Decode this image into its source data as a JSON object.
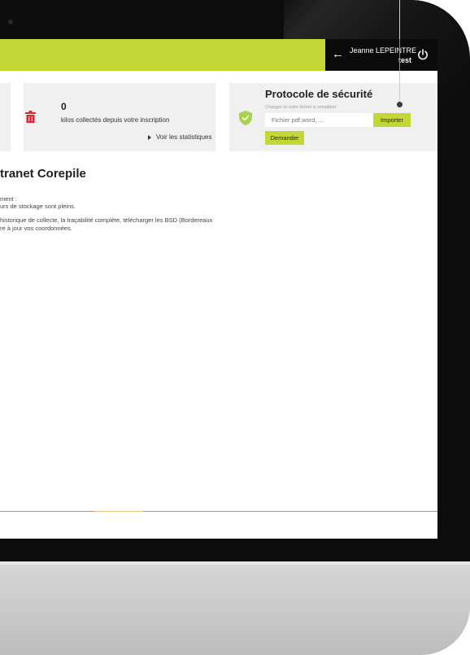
{
  "header": {
    "user_name": "Jeanne LEPEINTRE",
    "company": "test"
  },
  "collected_card": {
    "count": "0",
    "label": "kilos collectés depuis votre inscription",
    "stats_link": "Voir les statistiques"
  },
  "security": {
    "title": "Protocole de sécurité",
    "hint": "Chargez ici votre fichier à compléter",
    "file_placeholder": "Fichier pdf,word, ...",
    "import_label": "Importer",
    "request_label": "Demander"
  },
  "main": {
    "title": "tranet Corepile",
    "lines": [
      "ment :",
      "urs de stockage sont pleins.",
      "historique de collecte, la traçabilité complète, télécharger les BSD (Bordereaux",
      "re à jour vos coordonnées."
    ]
  },
  "colors": {
    "accent": "#c3d737",
    "userbar": "#0b0b0b",
    "card_bg": "#f0f0f0",
    "trash": "#d6283b",
    "shield": "#a8d24a"
  }
}
